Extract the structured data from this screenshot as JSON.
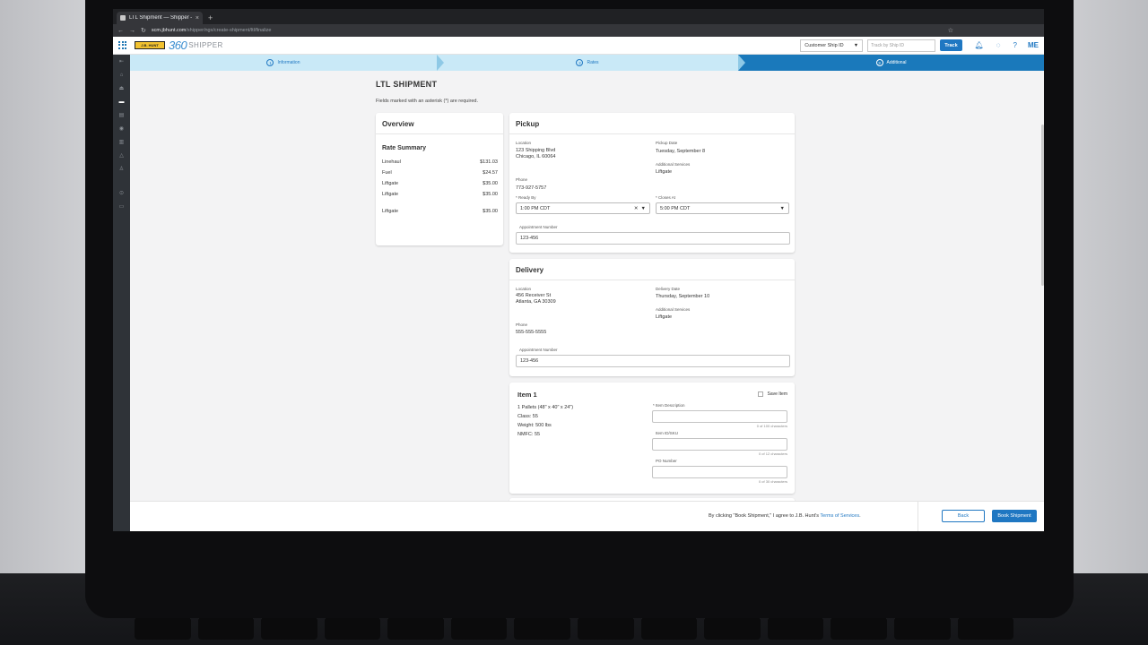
{
  "browser": {
    "tab_title": "LTL Shipment — Shipper — J.B.",
    "tab_close": "×",
    "new_tab": "+",
    "url_domain": "scm.jbhunt.com",
    "url_path": "/shipper/ngx/create-shipment/ltl/finalize"
  },
  "header": {
    "logo_text": "J.B. HUNT",
    "logo_360": "360",
    "logo_product": "SHIPPER",
    "ship_id_select": "Customer Ship ID",
    "track_placeholder": "Track by Ship ID",
    "track_button": "Track",
    "avatar_initials": "ME"
  },
  "stepper": [
    {
      "num": "1",
      "label": "Information"
    },
    {
      "num": "2",
      "label": "Rates"
    },
    {
      "num": "3",
      "label": "Additional"
    }
  ],
  "page": {
    "title": "LTL SHIPMENT",
    "required_note": "Fields marked with an asterisk (*) are required."
  },
  "overview": {
    "title": "Overview",
    "rate_summary_title": "Rate Summary",
    "rates": [
      {
        "label": "Linehaul",
        "amount": "$131.03"
      },
      {
        "label": "Fuel",
        "amount": "$24.57"
      },
      {
        "label": "Liftgate",
        "amount": "$35.00"
      },
      {
        "label": "Liftgate",
        "amount": "$35.00"
      },
      {
        "label": "Liftgate",
        "amount": "$35.00"
      }
    ]
  },
  "pickup": {
    "title": "Pickup",
    "location_label": "Location",
    "location_line1": "123 Shipping Blvd",
    "location_line2": "Chicago, IL 60064",
    "date_label": "Pickup Date",
    "date_value": "Tuesday, September 8",
    "services_label": "Additional Services",
    "services_value": "Liftgate",
    "phone_label": "Phone",
    "phone_value": "773-927-5757",
    "ready_by_label": "* Ready By",
    "ready_by_value": "1:00 PM CDT",
    "closes_at_label": "* Closes At",
    "closes_at_value": "5:00 PM CDT",
    "appointment_label": "Appointment Number",
    "appointment_value": "123-456"
  },
  "delivery": {
    "title": "Delivery",
    "location_label": "Location",
    "location_line1": "456 Receiver St",
    "location_line2": "Atlanta, GA 30309",
    "date_label": "Delivery Date",
    "date_value": "Thursday, September 10",
    "services_label": "Additional Services",
    "services_value": "Liftgate",
    "phone_label": "Phone",
    "phone_value": "555-555-5555",
    "appointment_label": "Appointment Number",
    "appointment_value": "123-456"
  },
  "item": {
    "title": "Item 1",
    "save_label": "Save Item",
    "pallets": "1 Pallets (48\" x 40\" x 24\")",
    "class": "Class: 55",
    "weight": "Weight: 500 lbs",
    "nmfc": "NMFC: 55",
    "description_label": "* Item Description",
    "description_count": "0 of 100 characters",
    "sku_label": "Item ID/SKU",
    "sku_count": "0 of 12 characters",
    "po_label": "PO Number",
    "po_count": "0 of 30 characters"
  },
  "footer": {
    "agree_text": "By clicking \"Book Shipment,\" I agree to J.B. Hunt's",
    "terms_link": "Terms of Services",
    "terms_period": ".",
    "back_button": "Back",
    "book_button": "Book Shipment"
  },
  "colors": {
    "primary": "#1f77c2",
    "stepper_active": "#1a79bb",
    "stepper_done": "#c9e9f7",
    "sidenav": "#2f3338"
  },
  "icons": {
    "sidenav": [
      "collapse-icon",
      "home-icon",
      "ship-icon",
      "truck-icon",
      "document-icon",
      "location-icon",
      "report-icon",
      "notification-icon",
      "user-icon",
      "settings-icon",
      "billing-icon"
    ],
    "header": [
      "bell-icon",
      "lightbulb-icon",
      "help-icon"
    ]
  }
}
